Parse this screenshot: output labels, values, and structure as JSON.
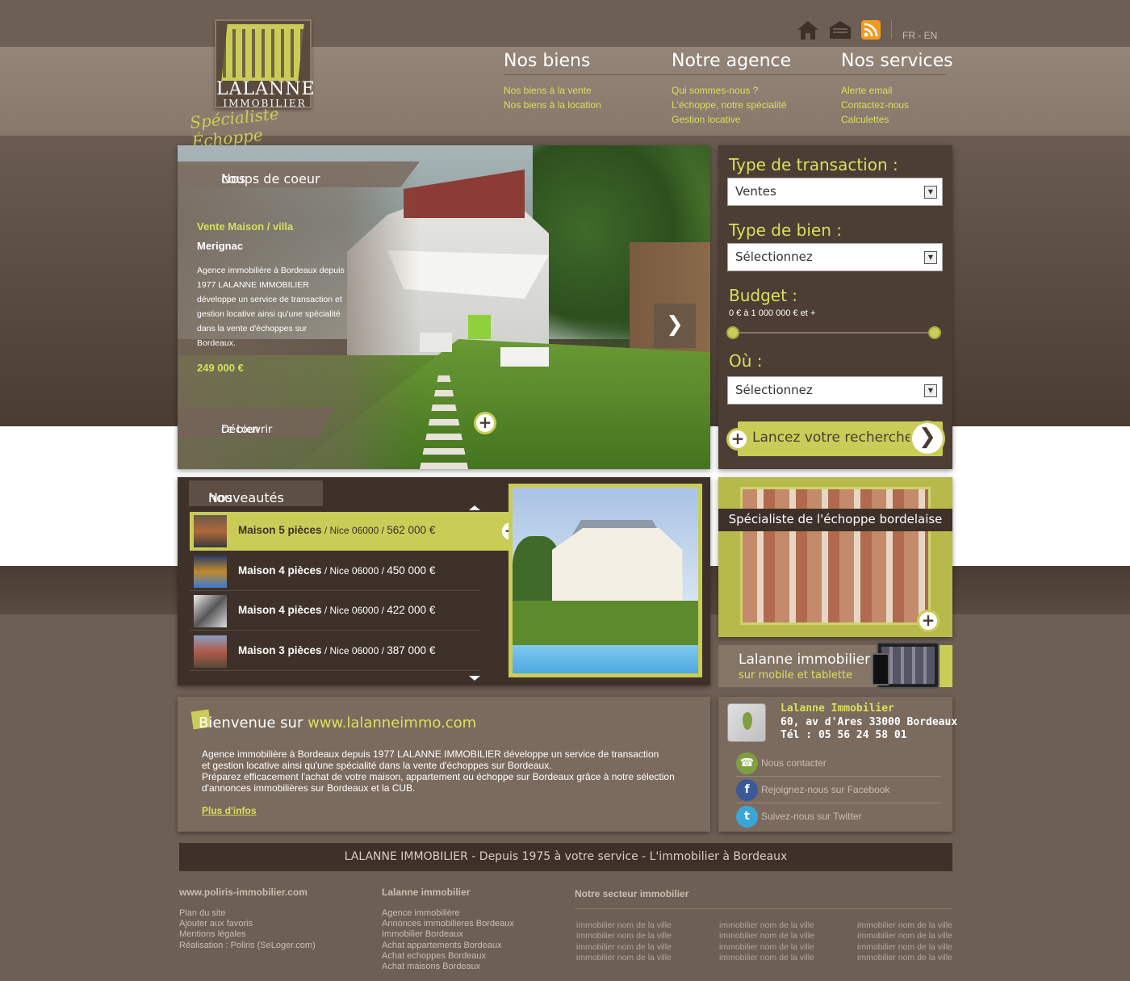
{
  "brand": {
    "logo_main": "LALANNE",
    "logo_sub": "IMMOBILIER",
    "logo_script": "Spécialiste Échoppe"
  },
  "header": {
    "icons": [
      "home-icon",
      "mail-icon",
      "rss-icon"
    ],
    "lang": "FR - EN"
  },
  "nav": [
    {
      "title": "Nos biens",
      "links": [
        "Nos biens à la vente",
        "Nos biens à la location"
      ]
    },
    {
      "title": "Notre agence",
      "links": [
        "Qui sommes-nous ?",
        "L'échoppe, notre spécialité",
        "Gestion locative"
      ]
    },
    {
      "title": "Nos services",
      "links": [
        "Alerte email",
        "Contactez-nous",
        "Calculettes"
      ]
    }
  ],
  "featured": {
    "tab_hl": "Nos",
    "tab_rest": " coups de coeur",
    "type": "Vente Maison / villa",
    "city": "Merignac",
    "desc": "Agence immobilière à Bordeaux depuis 1977 LALANNE IMMOBILIER développe un service de transaction et gestion locative ainsi qu'une spécialité dans la vente d'échoppes sur Bordeaux.",
    "price": "249 000 €",
    "cta_hl": "Découvrir",
    "cta_rest": " ce bien"
  },
  "search": {
    "transaction_label": "Type de transaction :",
    "transaction_value": "Ventes",
    "property_label": "Type de bien :",
    "property_value": "Sélectionnez",
    "budget_label": "Budget :",
    "budget_range": "0 € à 1 000 000 € et +",
    "budget_min": 0,
    "budget_max": 1,
    "where_label": "Où :",
    "where_value": "Sélectionnez",
    "submit_label": "Lancez votre recherche"
  },
  "news": {
    "tab_hl": "Nos",
    "tab_rest": " nouveautés",
    "items": [
      {
        "title": "Maison 5 pièces",
        "place": " / Nice 06000 / ",
        "price": "562 000 €"
      },
      {
        "title": "Maison 4 pièces",
        "place": " / Nice 06000 / ",
        "price": "450 000 €"
      },
      {
        "title": "Maison 4 pièces",
        "place": " / Nice 06000 / ",
        "price": "422 000 €"
      },
      {
        "title": "Maison 3 pièces",
        "place": " / Nice 06000 / ",
        "price": "387 000 €"
      }
    ]
  },
  "specialist": {
    "label": "Spécialiste de l'échoppe bordelaise"
  },
  "mobile": {
    "line1": "Lalanne immobilier",
    "line2": "sur mobile et tablette"
  },
  "welcome": {
    "title_prefix": "Bienvenue sur ",
    "title_url": "www.lalanneimmo.com",
    "p1": "Agence immobilière à Bordeaux depuis 1977 LALANNE IMMOBILIER développe un service de transaction",
    "p2": "et gestion locative ainsi qu'une spécialité dans la vente d'échoppes sur Bordeaux.",
    "p3": "Préparez efficacement l'achat de votre maison, appartement ou échoppe sur Bordeaux grâce à notre sélection",
    "p4": "d'annonces immobilières sur Bordeaux et la CUB.",
    "more": "Plus d'infos"
  },
  "contact": {
    "name": "Lalanne Immobilier",
    "address": "60, av d'Ares 33000 Bordeaux",
    "phone": "Tél : 05 56 24 58 01",
    "links": [
      {
        "icon": "phone-icon",
        "label": "Nous contacter",
        "color": "#7fa040"
      },
      {
        "icon": "facebook-icon",
        "label": "Rejoignez-nous sur Facebook",
        "color": "#3b5998"
      },
      {
        "icon": "twitter-icon",
        "label": "Suivez-nous sur Twitter",
        "color": "#3aa6d8"
      }
    ]
  },
  "footer": {
    "band": "LALANNE IMMOBILIER - Depuis 1975 à votre service - L'immobilier à Bordeaux",
    "col1_title": "www.poliris-immobilier.com",
    "col1_links": [
      "Plan du site",
      "Ajouter aux favoris",
      "Mentions légales",
      "Réalisation : Poliris (SeLoger.com)"
    ],
    "col2_title": "Lalanne immobilier",
    "col2_links": [
      "Agence immobilière",
      "Annonces immobilieres Bordeaux",
      "Immobilier Bordeaux",
      "Achat appartements Bordeaux",
      "Achat echoppes Bordeaux",
      "Achat maisons Bordeaux"
    ],
    "col3_title": "Notre secteur immobilier",
    "city_links": [
      "immobilier nom de la ville",
      "immobilier nom de la ville",
      "immobilier nom de la ville",
      "immobilier nom de la ville"
    ]
  },
  "colors": {
    "accent": "#c9cd57",
    "dark": "#3e312a",
    "mid": "#7b6b5e"
  }
}
